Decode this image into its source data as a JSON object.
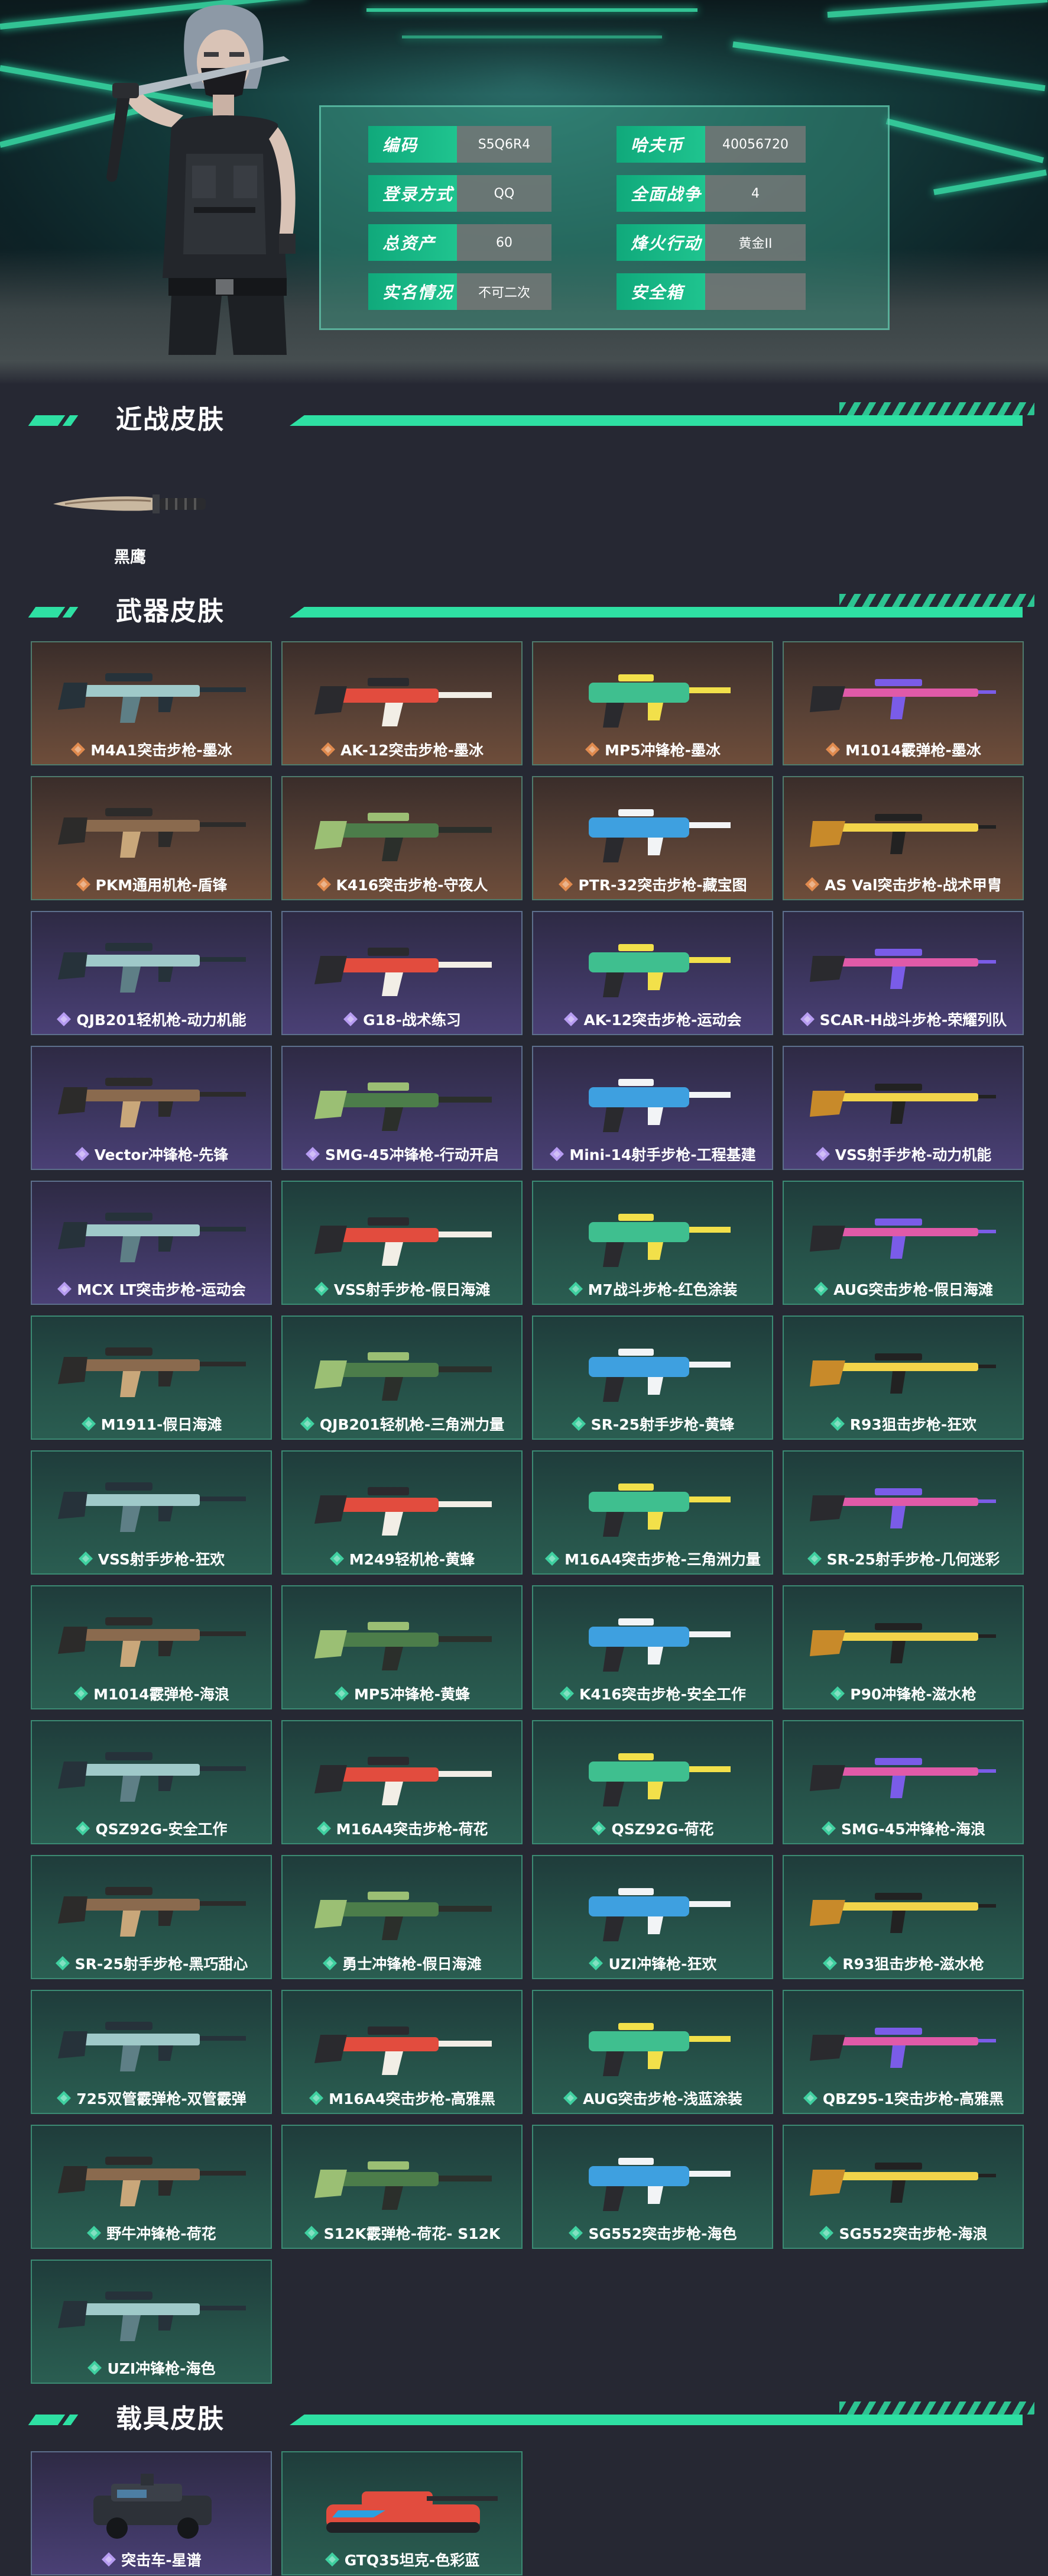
{
  "account_info": {
    "rows": [
      {
        "label": "编码",
        "value": "S5Q6R4"
      },
      {
        "label": "哈夫币",
        "value": "40056720"
      },
      {
        "label": "登录方式",
        "value": "QQ"
      },
      {
        "label": "全面战争",
        "value": "4"
      },
      {
        "label": "总资产",
        "value": "60"
      },
      {
        "label": "烽火行动",
        "value": "黄金II"
      },
      {
        "label": "实名情况",
        "value": "不可二次"
      },
      {
        "label": "安全箱",
        "value": ""
      }
    ]
  },
  "sections": {
    "melee_title": "近战皮肤",
    "weapon_title": "武器皮肤",
    "vehicle_title": "载具皮肤"
  },
  "melee_skins": [
    {
      "name": "黑鹰",
      "icon": "knife-icon"
    }
  ],
  "rarity_colors": {
    "orange": "#e08a4e",
    "purple": "#b79cf2",
    "green": "#3fd0a0",
    "accent": "#2ee0a3"
  },
  "weapon_skins": [
    {
      "name": "M4A1突击步枪-墨冰",
      "rarity": "orange"
    },
    {
      "name": "AK-12突击步枪-墨冰",
      "rarity": "orange"
    },
    {
      "name": "MP5冲锋枪-墨冰",
      "rarity": "orange"
    },
    {
      "name": "M1014霰弹枪-墨冰",
      "rarity": "orange"
    },
    {
      "name": "PKM通用机枪-盾锋",
      "rarity": "orange"
    },
    {
      "name": "K416突击步枪-守夜人",
      "rarity": "orange"
    },
    {
      "name": "PTR-32突击步枪-藏宝图",
      "rarity": "orange"
    },
    {
      "name": "AS Val突击步枪-战术甲胄",
      "rarity": "orange"
    },
    {
      "name": "QJB201轻机枪-动力机能",
      "rarity": "purple"
    },
    {
      "name": "G18-战术练习",
      "rarity": "purple"
    },
    {
      "name": "AK-12突击步枪-运动会",
      "rarity": "purple"
    },
    {
      "name": "SCAR-H战斗步枪-荣耀列队",
      "rarity": "purple"
    },
    {
      "name": "Vector冲锋枪-先锋",
      "rarity": "purple"
    },
    {
      "name": "SMG-45冲锋枪-行动开启",
      "rarity": "purple"
    },
    {
      "name": "Mini-14射手步枪-工程基建",
      "rarity": "purple"
    },
    {
      "name": "VSS射手步枪-动力机能",
      "rarity": "purple"
    },
    {
      "name": "MCX LT突击步枪-运动会",
      "rarity": "purple"
    },
    {
      "name": "VSS射手步枪-假日海滩",
      "rarity": "green"
    },
    {
      "name": "M7战斗步枪-红色涂装",
      "rarity": "green"
    },
    {
      "name": "AUG突击步枪-假日海滩",
      "rarity": "green"
    },
    {
      "name": "M1911-假日海滩",
      "rarity": "green"
    },
    {
      "name": "QJB201轻机枪-三角洲力量",
      "rarity": "green"
    },
    {
      "name": "SR-25射手步枪-黄蜂",
      "rarity": "green"
    },
    {
      "name": "R93狙击步枪-狂欢",
      "rarity": "green"
    },
    {
      "name": "VSS射手步枪-狂欢",
      "rarity": "green"
    },
    {
      "name": "M249轻机枪-黄蜂",
      "rarity": "green"
    },
    {
      "name": "M16A4突击步枪-三角洲力量",
      "rarity": "green"
    },
    {
      "name": "SR-25射手步枪-几何迷彩",
      "rarity": "green"
    },
    {
      "name": "M1014霰弹枪-海浪",
      "rarity": "green"
    },
    {
      "name": "MP5冲锋枪-黄蜂",
      "rarity": "green"
    },
    {
      "name": "K416突击步枪-安全工作",
      "rarity": "green"
    },
    {
      "name": "P90冲锋枪-滋水枪",
      "rarity": "green"
    },
    {
      "name": "QSZ92G-安全工作",
      "rarity": "green"
    },
    {
      "name": "M16A4突击步枪-荷花",
      "rarity": "green"
    },
    {
      "name": "QSZ92G-荷花",
      "rarity": "green"
    },
    {
      "name": "SMG-45冲锋枪-海浪",
      "rarity": "green"
    },
    {
      "name": "SR-25射手步枪-黑巧甜心",
      "rarity": "green"
    },
    {
      "name": "勇士冲锋枪-假日海滩",
      "rarity": "green"
    },
    {
      "name": "UZI冲锋枪-狂欢",
      "rarity": "green"
    },
    {
      "name": "R93狙击步枪-滋水枪",
      "rarity": "green"
    },
    {
      "name": "725双管霰弹枪-双管霰弹",
      "rarity": "green"
    },
    {
      "name": "M16A4突击步枪-高雅黑",
      "rarity": "green"
    },
    {
      "name": "AUG突击步枪-浅蓝涂装",
      "rarity": "green"
    },
    {
      "name": "QBZ95-1突击步枪-高雅黑",
      "rarity": "green"
    },
    {
      "name": "野牛冲锋枪-荷花",
      "rarity": "green"
    },
    {
      "name": "S12K霰弹枪-荷花- S12K",
      "rarity": "green"
    },
    {
      "name": "SG552突击步枪-海色",
      "rarity": "green"
    },
    {
      "name": "SG552突击步枪-海浪",
      "rarity": "green"
    },
    {
      "name": "UZI冲锋枪-海色",
      "rarity": "green"
    }
  ],
  "vehicle_skins": [
    {
      "name": "突击车-星谱",
      "rarity": "purple"
    },
    {
      "name": "GTQ35坦克-色彩蓝",
      "rarity": "green"
    }
  ]
}
